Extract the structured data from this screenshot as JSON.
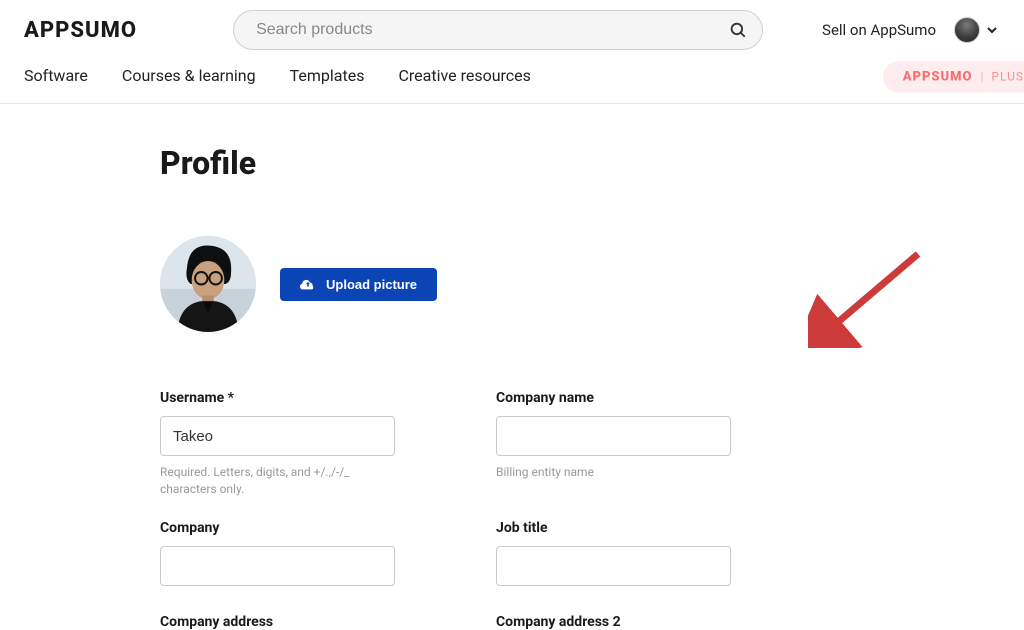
{
  "brand": "APPSUMO",
  "search": {
    "placeholder": "Search products"
  },
  "header": {
    "sell_link": "Sell on AppSumo"
  },
  "nav": {
    "items": [
      "Software",
      "Courses & learning",
      "Templates",
      "Creative resources"
    ]
  },
  "plus_badge": {
    "brand": "APPSUMO",
    "word": "PLUS"
  },
  "page": {
    "title": "Profile"
  },
  "upload": {
    "label": "Upload picture"
  },
  "form": {
    "username": {
      "label": "Username *",
      "value": "Takeo",
      "help": "Required. Letters, digits, and +/.,/-/_ characters only."
    },
    "company_name": {
      "label": "Company name",
      "value": "",
      "help": "Billing entity name"
    },
    "company": {
      "label": "Company",
      "value": ""
    },
    "job_title": {
      "label": "Job title",
      "value": ""
    },
    "company_address": {
      "label": "Company address"
    },
    "company_address_2": {
      "label": "Company address 2"
    }
  }
}
